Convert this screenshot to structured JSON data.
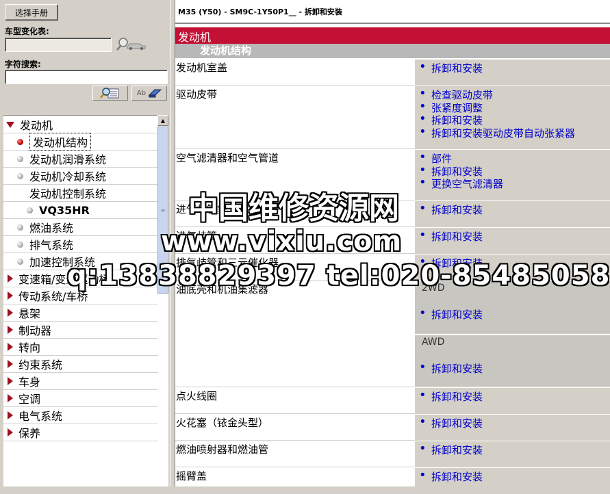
{
  "left": {
    "select_manual_button": "选择手册",
    "model_change_label": "车型变化表:",
    "model_change_value": "",
    "char_search_label": "字符搜索:",
    "char_search_value": "",
    "ab_button_text": "Ab",
    "tree": [
      {
        "label": "发动机",
        "kind": "expanded",
        "selected": false
      },
      {
        "label": "发动机结构",
        "kind": "leaf",
        "selected": true
      },
      {
        "label": "发动机润滑系统",
        "kind": "leaf",
        "selected": false
      },
      {
        "label": "发动机冷却系统",
        "kind": "leaf",
        "selected": false
      },
      {
        "label": "发动机控制系统",
        "kind": "open-sub",
        "selected": false
      },
      {
        "label": "VQ35HR",
        "kind": "deep-leaf",
        "selected": false
      },
      {
        "label": "燃油系统",
        "kind": "leaf",
        "selected": false
      },
      {
        "label": "排气系统",
        "kind": "leaf",
        "selected": false
      },
      {
        "label": "加速控制系统",
        "kind": "leaf",
        "selected": false
      },
      {
        "label": "变速箱/变速驱动桥",
        "kind": "collapsed",
        "selected": false
      },
      {
        "label": "传动系统/车桥",
        "kind": "collapsed",
        "selected": false
      },
      {
        "label": "悬架",
        "kind": "collapsed",
        "selected": false
      },
      {
        "label": "制动器",
        "kind": "collapsed",
        "selected": false
      },
      {
        "label": "转向",
        "kind": "collapsed",
        "selected": false
      },
      {
        "label": "约束系统",
        "kind": "collapsed",
        "selected": false
      },
      {
        "label": "车身",
        "kind": "collapsed",
        "selected": false
      },
      {
        "label": "空调",
        "kind": "collapsed",
        "selected": false
      },
      {
        "label": "电气系统",
        "kind": "collapsed",
        "selected": false
      },
      {
        "label": "保养",
        "kind": "collapsed",
        "selected": false
      }
    ]
  },
  "doc": {
    "title": "M35 (Y50) - SM9C-1Y50P1__ - 拆卸和安装",
    "section": "发动机",
    "subsection": "发动机结构",
    "rows": [
      {
        "name": "发动机室盖",
        "links": [
          "拆卸和安装"
        ]
      },
      {
        "name": "驱动皮带",
        "links": [
          "检查驱动皮带",
          "张紧度调整",
          "拆卸和安装",
          "拆卸和安装驱动皮带自动张紧器"
        ]
      },
      {
        "name": "空气滤清器和空气管道",
        "links": [
          "部件",
          "拆卸和安装",
          "更换空气滤清器"
        ]
      },
      {
        "name": "进气歧管集气室",
        "links": [
          "拆卸和安装"
        ]
      },
      {
        "name": "进气歧管",
        "links": [
          "拆卸和安装"
        ]
      },
      {
        "name": "排气歧管和三元催化器",
        "links": [
          "拆卸和安装"
        ]
      },
      {
        "name": "油底壳和机油集滤器",
        "groups": [
          {
            "label": "2WD",
            "links": [
              "拆卸和安装"
            ]
          },
          {
            "label": "AWD",
            "links": [
              "拆卸和安装"
            ]
          }
        ]
      },
      {
        "name": "点火线圈",
        "links": [
          "拆卸和安装"
        ]
      },
      {
        "name": "火花塞（铱金头型）",
        "links": [
          "拆卸和安装"
        ]
      },
      {
        "name": "燃油喷射器和燃油管",
        "links": [
          "拆卸和安装"
        ]
      },
      {
        "name": "摇臂盖",
        "links": [
          "拆卸和安装"
        ]
      }
    ]
  },
  "watermark": {
    "line1": "中国维修资源网",
    "line2": "www.vixiu.com",
    "line3": "q:13838829397  tel:020-85485058"
  },
  "colors": {
    "section_bar": "#c41034",
    "link": "#0000c8",
    "tree_arrow": "#a01020"
  }
}
